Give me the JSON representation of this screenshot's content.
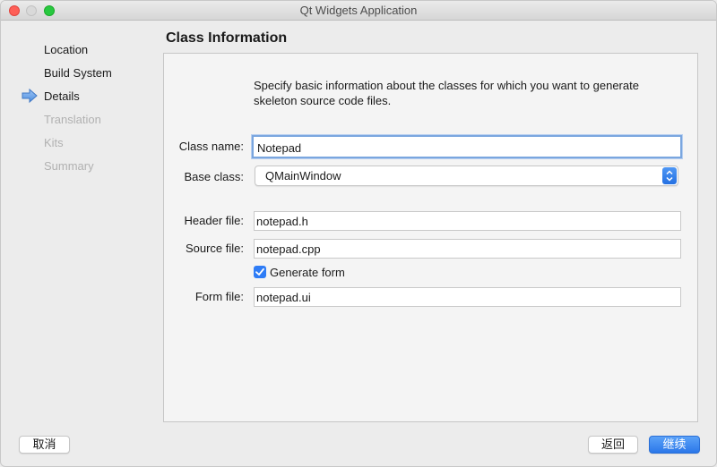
{
  "window": {
    "title": "Qt Widgets Application"
  },
  "steps": [
    {
      "label": "Location",
      "state": "done"
    },
    {
      "label": "Build System",
      "state": "done"
    },
    {
      "label": "Details",
      "state": "current"
    },
    {
      "label": "Translation",
      "state": "disabled"
    },
    {
      "label": "Kits",
      "state": "disabled"
    },
    {
      "label": "Summary",
      "state": "disabled"
    }
  ],
  "page": {
    "title": "Class Information",
    "description_line1": "Specify basic information about the classes for which you want to generate",
    "description_line2": "skeleton source code files."
  },
  "form": {
    "class_name": {
      "label": "Class name:",
      "value": "Notepad"
    },
    "base_class": {
      "label": "Base class:",
      "value": "QMainWindow"
    },
    "header_file": {
      "label": "Header file:",
      "value": "notepad.h"
    },
    "source_file": {
      "label": "Source file:",
      "value": "notepad.cpp"
    },
    "generate_form": {
      "label": "Generate form",
      "checked": true
    },
    "form_file": {
      "label": "Form file:",
      "value": "notepad.ui"
    }
  },
  "buttons": {
    "cancel": "取消",
    "back": "返回",
    "next": "继续"
  },
  "colors": {
    "accent": "#2e7cf6",
    "focus_ring": "#7aa6df",
    "disabled_text": "#b1b1b1"
  },
  "icons": {
    "current_step": "right-arrow-icon",
    "checkbox": "checkmark-icon",
    "select": "up-down-chevron-icon"
  }
}
